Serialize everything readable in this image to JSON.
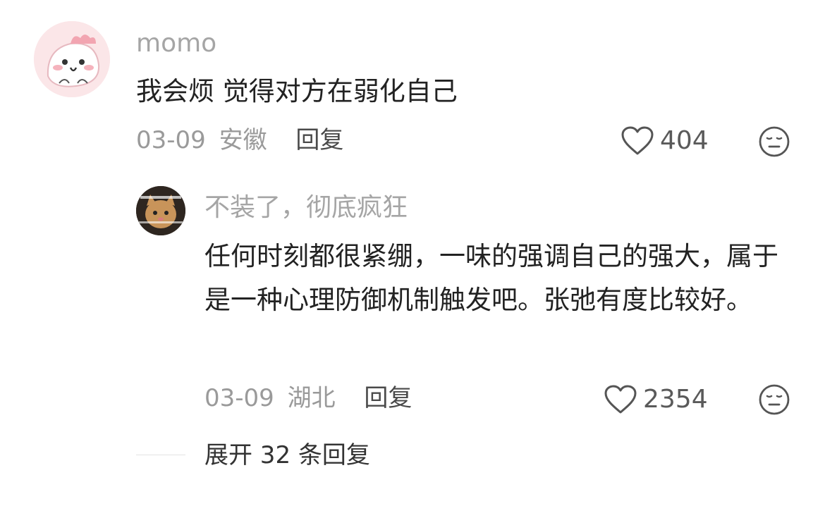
{
  "comments": [
    {
      "user": "momo",
      "text": "我会烦 觉得对方在弱化自己",
      "date": "03-09",
      "location": "安徽",
      "reply_label": "回复",
      "likes": "404"
    },
    {
      "user": "不装了，彻底疯狂",
      "text": "任何时刻都很紧绷，一味的强调自己的强大，属于是一种心理防御机制触发吧。张弛有度比较好。",
      "date": "03-09",
      "location": "湖北",
      "reply_label": "回复",
      "likes": "2354"
    }
  ],
  "expand_replies": "展开 32 条回复",
  "colors": {
    "username": "#a5a5a5",
    "meta": "#9a9a9a",
    "text": "#222222",
    "avatar_pink": "#fbe3e6"
  },
  "icons": [
    "heart-outline-icon",
    "neutral-face-icon"
  ]
}
